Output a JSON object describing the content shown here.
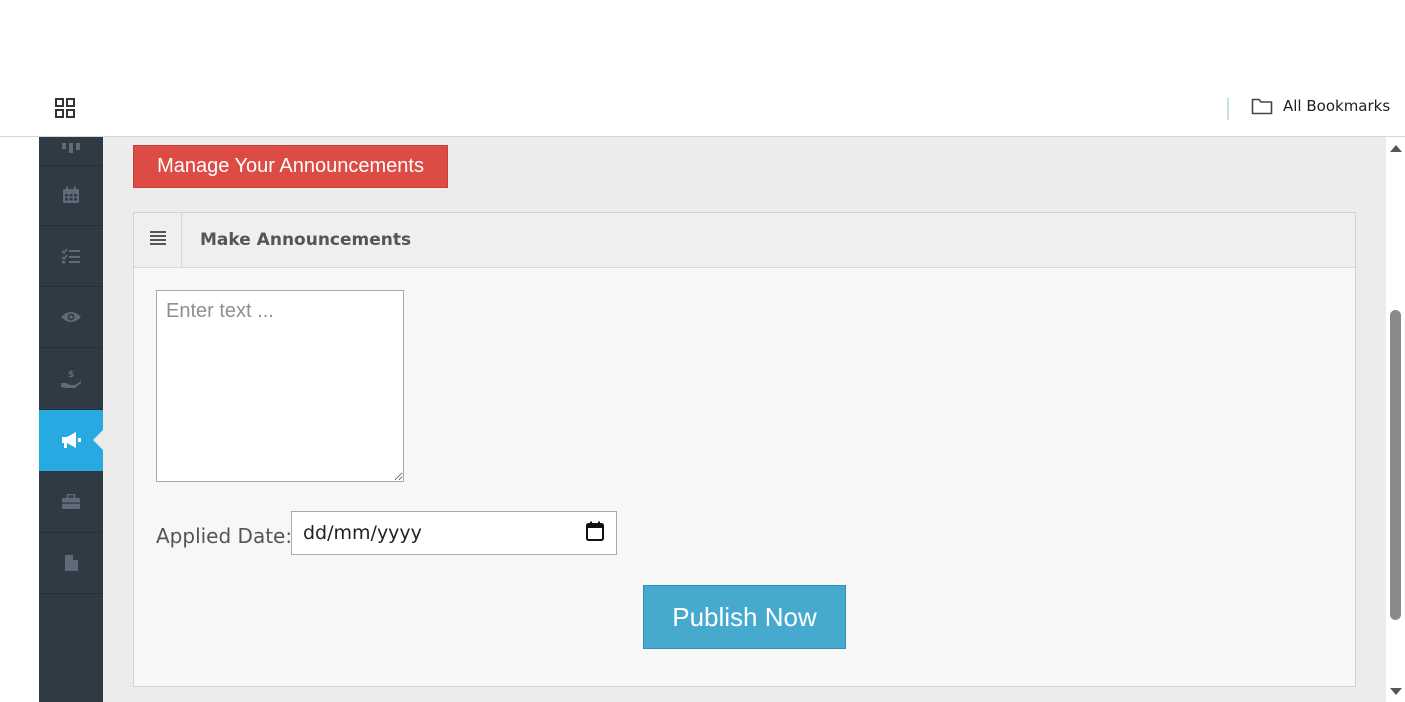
{
  "bookmarks_bar": {
    "apps_icon": "apps-grid-icon",
    "all_bookmarks_label": "All Bookmarks",
    "folder_icon": "folder-icon"
  },
  "sidebar": {
    "active_color": "#27a9e1",
    "items": [
      {
        "icon": "dashboard-icon",
        "active": false
      },
      {
        "icon": "calendar-icon",
        "active": false
      },
      {
        "icon": "task-list-icon",
        "active": false
      },
      {
        "icon": "eye-icon",
        "active": false
      },
      {
        "icon": "hand-dollar-icon",
        "active": false
      },
      {
        "icon": "megaphone-icon",
        "active": true
      },
      {
        "icon": "briefcase-icon",
        "active": false
      },
      {
        "icon": "file-icon",
        "active": false
      }
    ]
  },
  "manage_button": {
    "label": "Manage Your Announcements",
    "color": "#dd4b45"
  },
  "panel": {
    "title": "Make Announcements",
    "menu_icon": "list-lines-icon",
    "textarea": {
      "placeholder": "Enter text ...",
      "value": ""
    },
    "date_label": "Applied Date:",
    "date_input": {
      "placeholder": "dd/mm/yyyy",
      "value": "",
      "icon": "calendar-picker-icon"
    },
    "publish_label": "Publish Now",
    "publish_color": "#46aacf"
  }
}
